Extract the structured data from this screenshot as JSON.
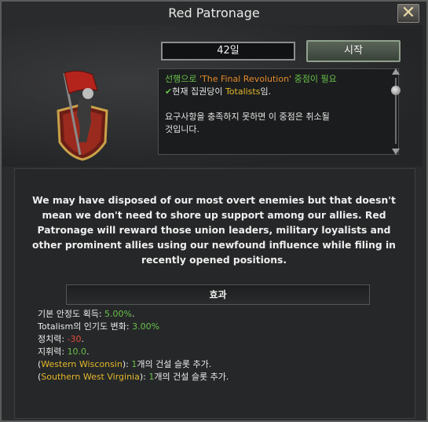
{
  "window": {
    "title": "Red Patronage",
    "close_symbol": "✕"
  },
  "header": {
    "days_text": "42일",
    "start_label": "시작"
  },
  "requirements": {
    "line1_prefix": "선행으로 ",
    "line1_focus": "'The Final Revolution'",
    "line1_suffix": " 중점이 필요",
    "check_icon": "✔",
    "line2_prefix": "현재 집권당이 ",
    "line2_ideology": "Totalists",
    "line2_suffix": "임.",
    "line3": "요구사항을 충족하지 못하면 이 중점은 취소될",
    "line4": "것입니다."
  },
  "description": "We may have disposed of our most overt enemies but that doesn't mean we don't need to shore up support among our allies. Red Patronage will reward those union leaders, military loyalists and other prominent allies using our newfound influence while filing in recently opened positions.",
  "effects": {
    "header": "효과",
    "stability_label": "기본 안정도 획득: ",
    "stability_value": "5.00%",
    "stability_end": ".",
    "pop_label": "Totalism의 인기도 변화: ",
    "pop_value": "3.00%",
    "pp_label": "정치력: ",
    "pp_value": "-30",
    "pp_end": ".",
    "cmd_label": "지휘력: ",
    "cmd_value": "10.0",
    "cmd_end": ".",
    "state1_open": "(",
    "state1_name": "Western Wisconsin",
    "state1_mid": "): ",
    "state1_count": "1",
    "state1_tail": "개의 건설 슬롯 추가.",
    "state2_open": "(",
    "state2_name": "Southern West Virginia",
    "state2_mid": "): ",
    "state2_count": "1",
    "state2_tail": "개의 건설 슬롯 추가."
  },
  "colors": {
    "positive": "#69c04b",
    "negative": "#e04a3a",
    "highlight": "#e3b82a"
  },
  "icons": {
    "emblem": "red-flag-shield-icon",
    "close": "close-icon",
    "check": "check-icon"
  }
}
